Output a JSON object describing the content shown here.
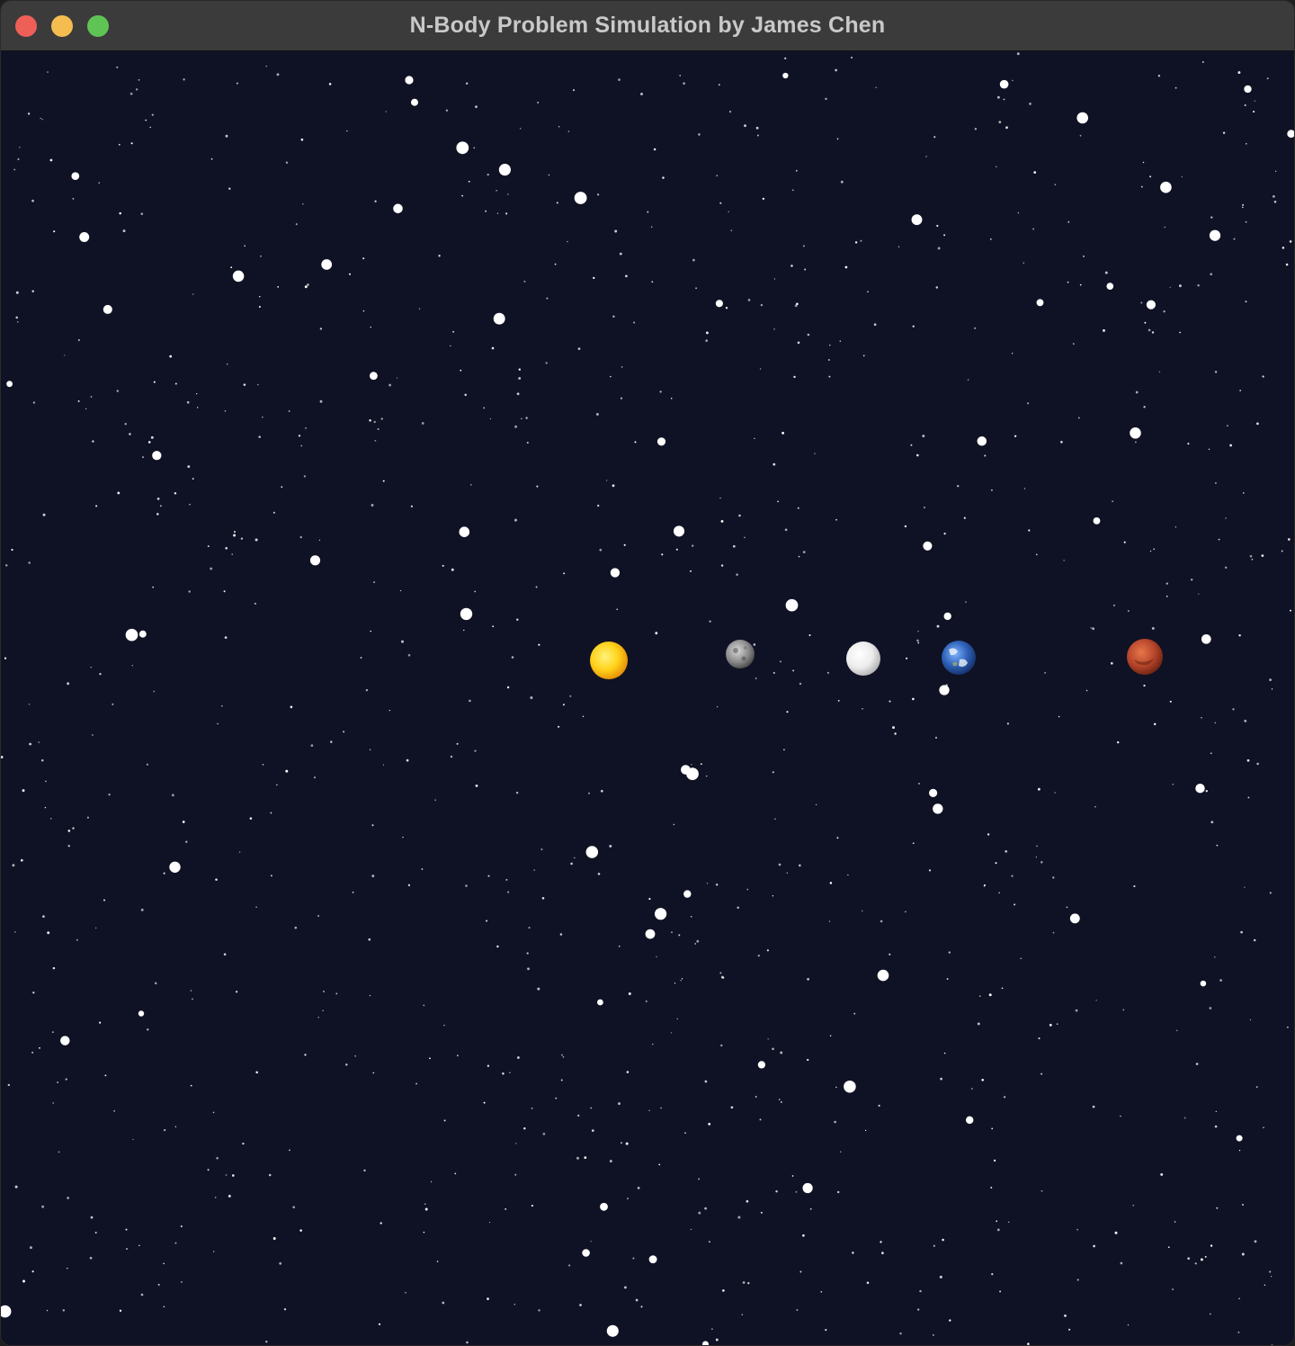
{
  "window": {
    "title": "N-Body Problem Simulation by James Chen"
  },
  "window_controls": {
    "close": "close-button",
    "minimize": "minimize-button",
    "maximize": "zoom-button"
  },
  "scene": {
    "background_color": "#0f1224",
    "star_color": "#ffffff",
    "bodies": [
      {
        "name": "sun",
        "icon": "sun-icon",
        "color": "#f6b80f"
      },
      {
        "name": "mercury",
        "icon": "mercury-icon",
        "color": "#9a9a9a"
      },
      {
        "name": "venus",
        "icon": "venus-icon",
        "color": "#e6e6e6"
      },
      {
        "name": "earth",
        "icon": "earth-icon",
        "color": "#2a5aa8"
      },
      {
        "name": "mars",
        "icon": "mars-icon",
        "color": "#b8482a"
      }
    ]
  }
}
